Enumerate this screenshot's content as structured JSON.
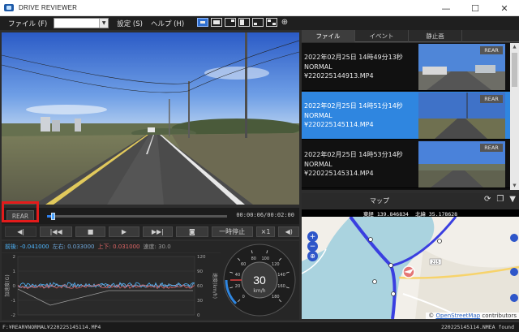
{
  "window": {
    "title": "DRIVE REVIEWER",
    "minimize": "—",
    "maximize": "☐",
    "close": "✕"
  },
  "menu": {
    "file": "ファイル (F)",
    "combo_value": "",
    "settings": "設定 (S)",
    "help": "ヘルプ (H)"
  },
  "player": {
    "rear_label": "REAR",
    "progress": 0.03,
    "time": "00:00:06/00:02:00",
    "pause_label": "一時停止",
    "speed_label": "×1"
  },
  "gsensor": {
    "front_back": "前後: -0.041000",
    "left_right": "左右: 0.033000",
    "up_down": "上下: 0.031000",
    "speed_readout": "速度: 30.0",
    "colors": {
      "front_back": "#4fb7ff",
      "left_right": "#6fa8dc",
      "up_down": "#e06666",
      "speed": "#9a9a9a"
    },
    "left_axis_label": "加速度(G)",
    "right_axis_label": "速度(km/h)",
    "left_ticks": [
      "2",
      "1",
      "0",
      "-1",
      "-2"
    ],
    "right_ticks": [
      "120",
      "90",
      "60",
      "30",
      "0"
    ]
  },
  "speedometer": {
    "value": 30,
    "unit": "km/h",
    "max": 180,
    "ticks": [
      "0",
      "20",
      "40",
      "60",
      "80",
      "100",
      "120",
      "140",
      "160",
      "180"
    ]
  },
  "tabs": [
    {
      "label": "ファイル",
      "active": true
    },
    {
      "label": "イベント",
      "active": false
    },
    {
      "label": "静止画",
      "active": false
    }
  ],
  "files": [
    {
      "date": "2022年02月25日 14時49分13秒",
      "type": "NORMAL",
      "name": "¥220225144913.MP4",
      "badge": "REAR",
      "selected": false
    },
    {
      "date": "2022年02月25日 14時51分14秒",
      "type": "NORMAL",
      "name": "¥220225145114.MP4",
      "badge": "REAR",
      "selected": true
    },
    {
      "date": "2022年02月25日 14時53分14秒",
      "type": "NORMAL",
      "name": "¥220225145314.MP4",
      "badge": "REAR",
      "selected": false
    }
  ],
  "map": {
    "title": "マップ",
    "longitude": "東経 139.846834",
    "latitude": "北緯 35.178628",
    "attribution_symbol": "©",
    "attribution_link": "OpenStreetMap",
    "attribution_suffix": "contributors",
    "road_label": "215",
    "zoom_in": "+",
    "zoom_out": "−"
  },
  "status": {
    "path": "F:¥REAR¥NORMAL¥220225145114.MP4",
    "info": "220225145114.NMEA found"
  }
}
